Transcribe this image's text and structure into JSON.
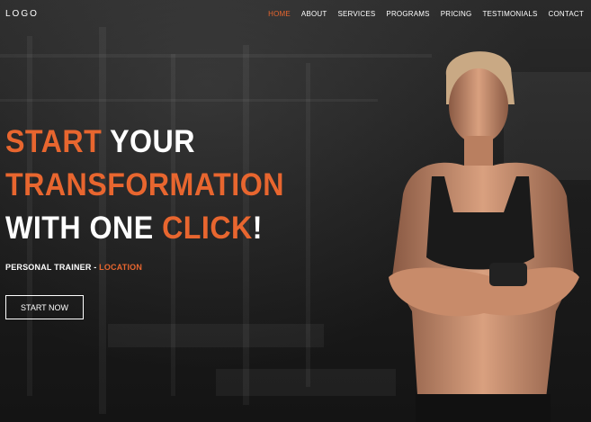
{
  "nav": {
    "logo": "LOGO",
    "items": [
      {
        "label": "HOME",
        "active": true
      },
      {
        "label": "ABOUT",
        "active": false
      },
      {
        "label": "SERVICES",
        "active": false
      },
      {
        "label": "PROGRAMS",
        "active": false
      },
      {
        "label": "PRICING",
        "active": false
      },
      {
        "label": "TESTIMONIALS",
        "active": false
      },
      {
        "label": "CONTACT",
        "active": false
      }
    ]
  },
  "hero": {
    "line1": {
      "a": "START",
      "b": "YOUR"
    },
    "line2": "TRANSFORMATION",
    "line3": {
      "a": "WITH ONE",
      "b": "CLICK",
      "c": "!"
    },
    "subtitle": {
      "a": "PERSONAL TRAINER - ",
      "b": "LOCATION"
    },
    "cta": "START NOW"
  },
  "colors": {
    "accent": "#e8662f",
    "text": "#ffffff",
    "background": "#1c1c1c"
  }
}
